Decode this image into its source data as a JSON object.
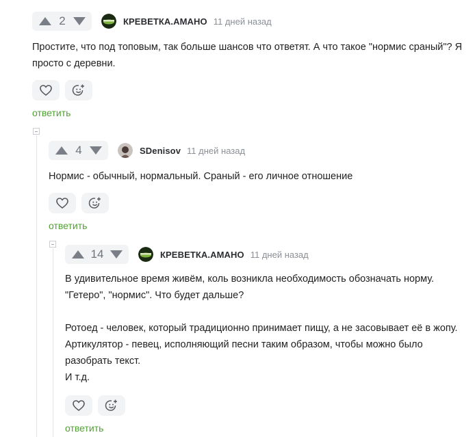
{
  "comments": [
    {
      "score": "2",
      "author": "КРЕВЕТКА.АМАНО",
      "time": "11 дней назад",
      "paragraphs": [
        "Простите, что под топовым, так больше шансов что ответят. А что такое \"нормис сраный\"? Я просто с деревни."
      ],
      "reply_label": "ответить"
    },
    {
      "score": "4",
      "author": "SDenisov",
      "time": "11 дней назад",
      "paragraphs": [
        "Нормис - обычный, нормальный. Сраный - его личное отношение"
      ],
      "reply_label": "ответить"
    },
    {
      "score": "14",
      "author": "КРЕВЕТКА.АМАНО",
      "time": "11 дней назад",
      "paragraphs": [
        "В удивительное время живём, коль возникла необходимость обозначать норму. \"Гетеро\", \"нормис\". Что будет дальше?",
        "",
        "Ротоед - человек, который традиционно принимает пищу, а не засовывает её в жопу.",
        "Артикулятор - певец, исполняющий песни таким образом, чтобы можно было разобрать текст.",
        "И т.д."
      ],
      "reply_label": "ответить"
    }
  ],
  "colors": {
    "accent": "#4f9f32",
    "vote_bg": "#f2f3f5",
    "meta": "#8a8f96"
  },
  "icons": [
    "upvote-arrow-icon",
    "downvote-arrow-icon",
    "heart-icon",
    "add-emoji-icon",
    "collapse-thread-icon"
  ]
}
